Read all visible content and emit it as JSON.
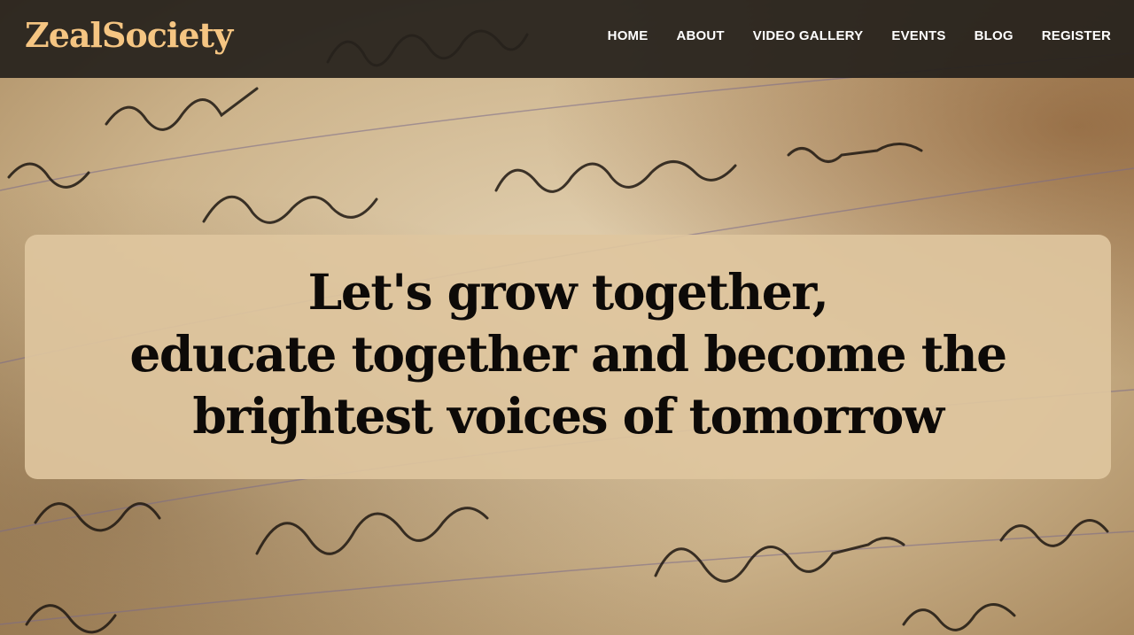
{
  "brand": {
    "name": "ZealSociety",
    "color": "#f5c582"
  },
  "nav": {
    "items": [
      {
        "label": "HOME"
      },
      {
        "label": "ABOUT"
      },
      {
        "label": "VIDEO GALLERY"
      },
      {
        "label": "EVENTS"
      },
      {
        "label": "BLOG"
      },
      {
        "label": "REGISTER"
      }
    ]
  },
  "hero": {
    "lines": [
      "Let's grow together,",
      "educate together and become the",
      "brightest voices of tomorrow"
    ],
    "background": "handwritten-letter-image"
  },
  "colors": {
    "navbar": "#26211c",
    "card": "#dec69e",
    "heading": "#0d0a08"
  }
}
